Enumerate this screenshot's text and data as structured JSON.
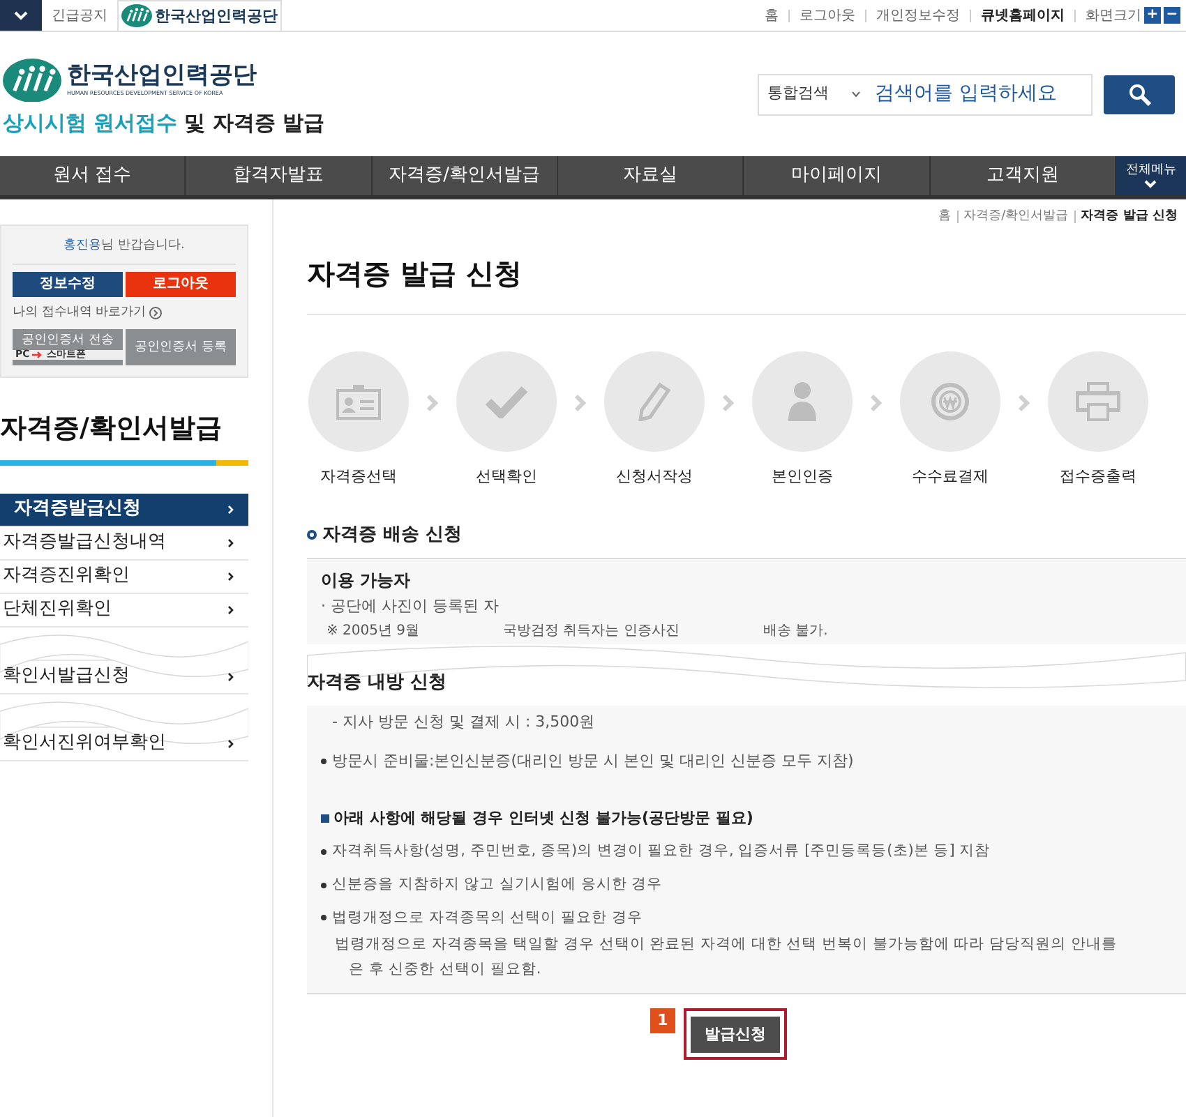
{
  "top_bar": {
    "notice": "긴급공지",
    "org_badge": "한국산업인력공단",
    "links": [
      {
        "label": "홈",
        "bold": false
      },
      {
        "label": "로그아웃",
        "bold": false
      },
      {
        "label": "개인정보수정",
        "bold": false
      },
      {
        "label": "큐넷홈페이지",
        "bold": true
      }
    ],
    "font_size_label": "화면크기",
    "font_buttons": [
      "+",
      "−"
    ]
  },
  "header": {
    "logo_title": "한국산업인력공단",
    "logo_subtitle": "HUMAN RESOURCES DEVELOPMENT SERVICE OF KOREA",
    "site_title_highlight": "상시시험 원서접수",
    "site_title_rest": "및 자격증 발급",
    "search": {
      "scope": "통합검색",
      "placeholder": "검색어를 입력하세요"
    }
  },
  "nav": {
    "items": [
      "원서 접수",
      "합격자발표",
      "자격증/확인서발급",
      "자료실",
      "마이페이지",
      "고객지원"
    ],
    "all_menu": "전체메뉴"
  },
  "sidebar": {
    "user_name": "홍진용",
    "greeting": "님 반갑습니다.",
    "buttons": [
      {
        "label": "정보수정",
        "kind": "info"
      },
      {
        "label": "로그아웃",
        "kind": "logout"
      }
    ],
    "history_link": "나의 접수내역 바로가기",
    "cert_buttons": [
      {
        "label": "공인인증서 전송",
        "sub_left": "PC",
        "sub_right": "스마트폰"
      },
      {
        "label": "공인인증서 등록"
      }
    ],
    "heading": "자격증/확인서발급",
    "menu": [
      {
        "label": "자격증발급신청",
        "selected": true
      },
      {
        "label": "자격증발급신청내역",
        "selected": false
      },
      {
        "label": "자격증진위확인",
        "selected": false
      },
      {
        "label": "단체진위확인",
        "selected": false
      },
      {
        "label": "확인서발급신청",
        "selected": false
      },
      {
        "label": "확인서진위여부확인",
        "selected": false
      }
    ]
  },
  "main": {
    "breadcrumb": [
      {
        "label": "홈",
        "current": false
      },
      {
        "label": "자격증/확인서발급",
        "current": false
      },
      {
        "label": "자격증 발급 신청",
        "current": true
      }
    ],
    "title": "자격증 발급 신청",
    "steps": [
      {
        "label": "자격증선택",
        "kind": "card"
      },
      {
        "label": "선택확인",
        "kind": "check"
      },
      {
        "label": "신청서작성",
        "kind": "pencil"
      },
      {
        "label": "본인인증",
        "kind": "person"
      },
      {
        "label": "수수료결제",
        "kind": "coin"
      },
      {
        "label": "접수증출력",
        "kind": "printer"
      }
    ],
    "delivery": {
      "heading": "자격증 배송 신청",
      "box_title": "이용 가능자",
      "lines": [
        "· 공단에 사진이 등록된 자"
      ],
      "note_fragments": [
        "※ 2005년 9월",
        "국방검정 취득자는 인증사진",
        "배송 불가."
      ]
    },
    "visit": {
      "heading": "자격증 내방 신청",
      "fee_line": "- 지사 방문 신청 및 결제 시 : 3,500원",
      "bullets": [
        "방문시 준비물:본인신분증(대리인 방문 시 본인 및 대리인 신분증 모두 지참)"
      ],
      "notice_heading": "아래 사항에 해당될 경우 인터넷 신청 불가능(공단방문 필요)",
      "notice_bullets": [
        {
          "text": "자격취득사항(성명, 주민번호, 종목)의 변경이 필요한 경우, 입증서류 [주민등록등(초)본 등] 지참"
        },
        {
          "text": "신분증을 지참하지 않고 실기시험에 응시한 경우"
        },
        {
          "text": "법령개정으로 자격종목의 선택이 필요한 경우",
          "detail": "법령개정으로 자격종목을 택일할 경우 선택이 완료된 자격에 대한 선택 번복이 불가능함에 따라 담당직원의 안내를",
          "detail2": "은 후 신중한 선택이 필요함."
        }
      ]
    },
    "submit": {
      "marker": "1",
      "label": "발급신청"
    }
  }
}
